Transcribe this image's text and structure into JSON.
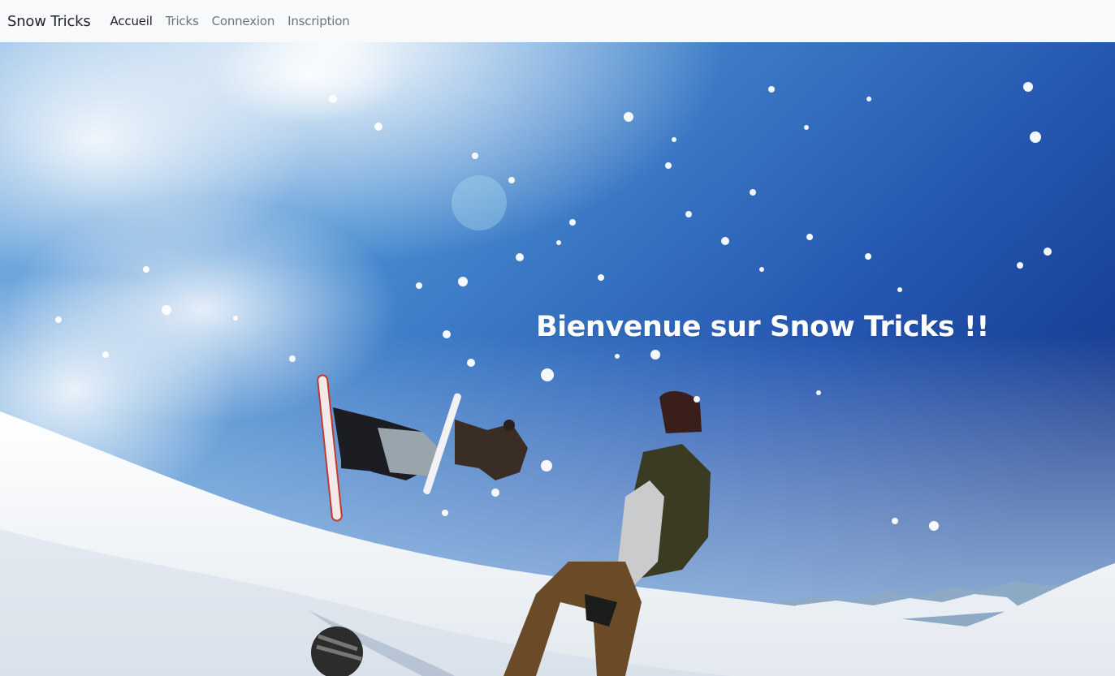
{
  "navbar": {
    "brand": "Snow Tricks",
    "items": [
      {
        "label": "Accueil",
        "active": true
      },
      {
        "label": "Tricks",
        "active": false
      },
      {
        "label": "Connexion",
        "active": false
      },
      {
        "label": "Inscription",
        "active": false
      }
    ]
  },
  "hero": {
    "title": "Bienvenue sur Snow Tricks !!"
  },
  "colors": {
    "navbar_bg": "#f8f9fa",
    "nav_active": "#212529",
    "nav_muted": "#6c757d",
    "sky_top": "#16409a",
    "sky_mid": "#3f88cf",
    "snow": "#f4f7fa"
  }
}
